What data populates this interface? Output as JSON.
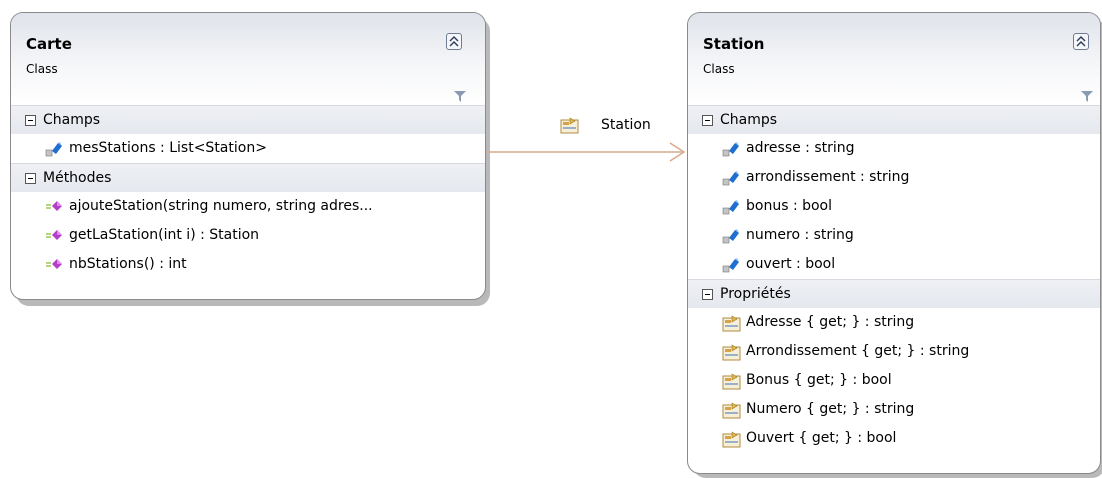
{
  "carte": {
    "name": "Carte",
    "stereotype": "Class",
    "sections": {
      "fields": {
        "label": "Champs",
        "members": [
          "mesStations : List<Station>"
        ]
      },
      "methods": {
        "label": "Méthodes",
        "members": [
          "ajouteStation(string numero, string adres...",
          "getLaStation(int i) : Station",
          "nbStations() : int"
        ]
      }
    }
  },
  "station": {
    "name": "Station",
    "stereotype": "Class",
    "sections": {
      "fields": {
        "label": "Champs",
        "members": [
          "adresse : string",
          "arrondissement : string",
          "bonus : bool",
          "numero : string",
          "ouvert : bool"
        ]
      },
      "properties": {
        "label": "Propriétés",
        "members": [
          "Adresse { get; } : string",
          "Arrondissement { get; } : string",
          "Bonus { get; } : bool",
          "Numero { get; } : string",
          "Ouvert { get; } : bool"
        ]
      }
    }
  },
  "association": {
    "label": "Station"
  },
  "icons": {
    "field": "field-icon",
    "method": "method-icon",
    "property": "property-icon",
    "collapse": "collapse-icon",
    "filter": "filter-icon",
    "toggle": "minus-toggle-icon"
  },
  "colors": {
    "connector": "#d7a98d",
    "field_icon": "#1f6fd1",
    "method_icon": "#b23ec9",
    "property_icon": "#e0b54b"
  }
}
